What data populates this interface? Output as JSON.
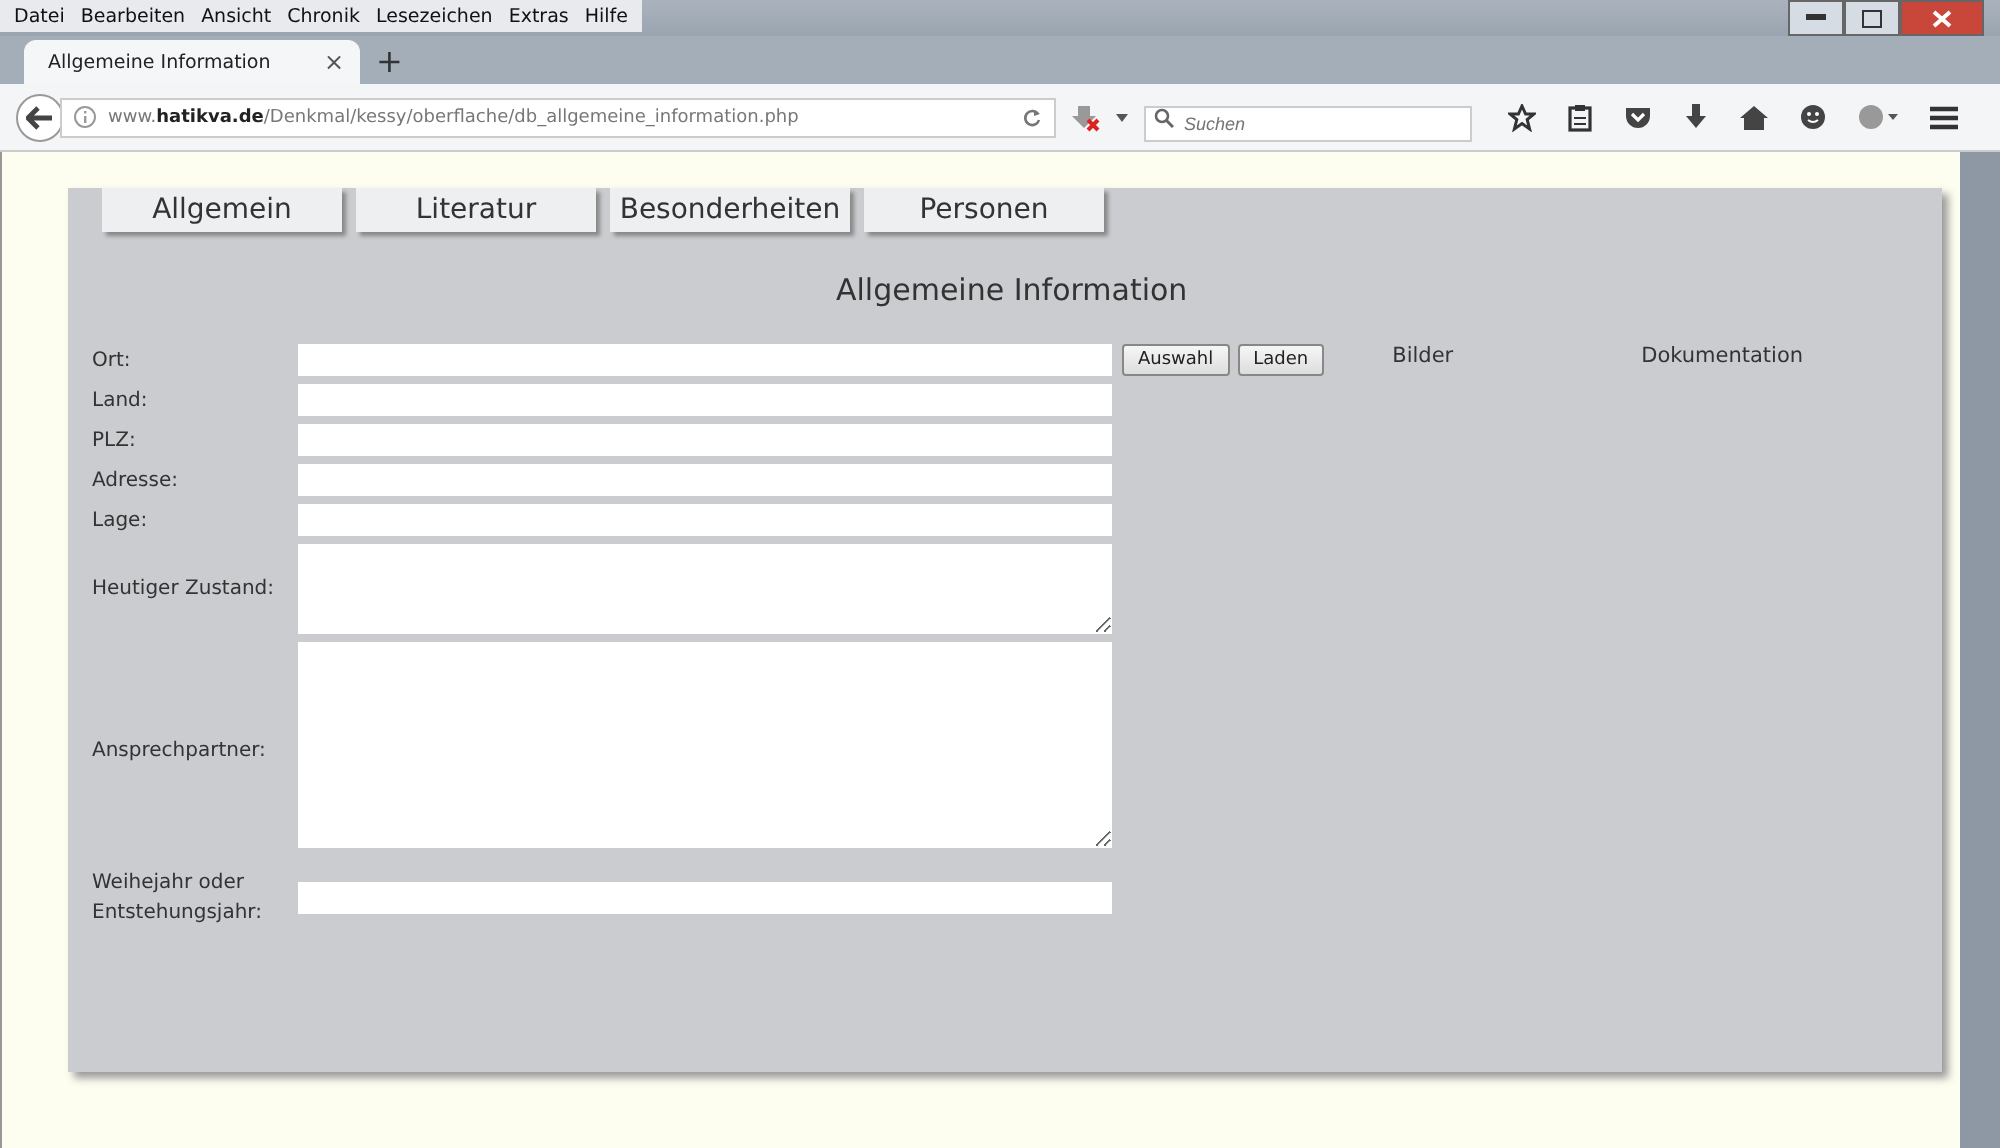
{
  "menu": [
    "Datei",
    "Bearbeiten",
    "Ansicht",
    "Chronik",
    "Lesezeichen",
    "Extras",
    "Hilfe"
  ],
  "browser_tab": {
    "title": "Allgemeine Information",
    "close": "×",
    "new_tab": "+"
  },
  "address_bar": {
    "url_prefix": "www.",
    "url_domain": "hatikva.de",
    "url_path": "/Denkmal/kessy/oberflache/db_allgemeine_information.php"
  },
  "search": {
    "placeholder": "Suchen"
  },
  "page_tabs": [
    "Allgemein",
    "Literatur",
    "Besonderheiten",
    "Personen"
  ],
  "heading": "Allgemeine Information",
  "fields": [
    {
      "label": "Ort:",
      "kind": "input"
    },
    {
      "label": "Land:",
      "kind": "input"
    },
    {
      "label": "PLZ:",
      "kind": "input"
    },
    {
      "label": "Adresse:",
      "kind": "input"
    },
    {
      "label": "Lage:",
      "kind": "input"
    },
    {
      "label": "Heutiger Zustand:",
      "kind": "textarea"
    },
    {
      "label": "Ansprechpartner:",
      "kind": "tall-textarea"
    },
    {
      "label": "Weihejahr oder Entstehungsjahr:",
      "kind": "input"
    }
  ],
  "buttons": [
    "Auswahl",
    "Laden"
  ],
  "columns": [
    "Bilder",
    "Dokumentation"
  ]
}
